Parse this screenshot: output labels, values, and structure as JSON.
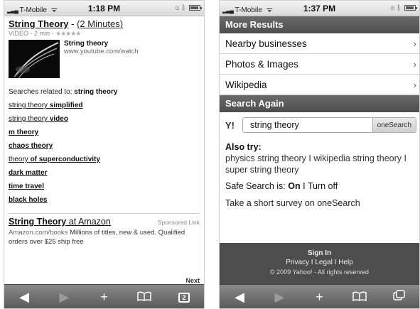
{
  "left": {
    "status": {
      "carrier": "T-Mobile",
      "time": "1:18 PM"
    },
    "result": {
      "title": "String Theory",
      "dash": " - ",
      "duration": "(2 Minutes)",
      "subline": "VIDEO - 2 min - ",
      "stars": "★★★★★",
      "video_title": "String theory",
      "video_url": "www.youtube.com/watch"
    },
    "related": {
      "prefix": "Searches related to: ",
      "query": "string theory",
      "items": [
        {
          "plain": "string theory ",
          "bold": "simplified"
        },
        {
          "plain": "string theory ",
          "bold": "video"
        },
        {
          "plain": "",
          "bold": "m theory"
        },
        {
          "plain": "",
          "bold": "chaos theory"
        },
        {
          "plain": "theory ",
          "bold": "of superconductivity"
        },
        {
          "plain": "",
          "bold": "dark matter"
        },
        {
          "plain": "",
          "bold": "time travel"
        },
        {
          "plain": "",
          "bold": "black holes"
        }
      ]
    },
    "ad": {
      "title_bold": "String Theory",
      "title_rest": " at Amazon",
      "sponsored": "Sponsored Link",
      "url": "Amazon.com/books",
      "desc": " Millions of titles, new & used. Qualified orders over $25 ship free",
      "next": "Next"
    }
  },
  "right": {
    "status": {
      "carrier": "T-Mobile",
      "time": "1:37 PM"
    },
    "more_results_header": "More Results",
    "menu": [
      "Nearby businesses",
      "Photos & Images",
      "Wikipedia"
    ],
    "search_again_header": "Search Again",
    "yahoo_icon": "Y!",
    "search_value": "string theory",
    "search_button": "oneSearch",
    "also_try_title": "Also try:",
    "also_try_links": [
      "physics string theory",
      "wikipedia string theory",
      "super string theory"
    ],
    "separator": " I ",
    "safe_search_label": "Safe Search is: ",
    "safe_on": "On",
    "safe_off": "Turn off",
    "survey": "Take a short survey on oneSearch",
    "footer": {
      "sign_in": "Sign In",
      "privacy": "Privacy",
      "legal": "Legal",
      "help": "Help",
      "copyright": "© 2009 Yahoo! - All rights reserved"
    }
  },
  "toolbar": {
    "back": "◀",
    "forward": "▶",
    "add": "+",
    "bookmarks": "📖",
    "pages_left": "2"
  }
}
